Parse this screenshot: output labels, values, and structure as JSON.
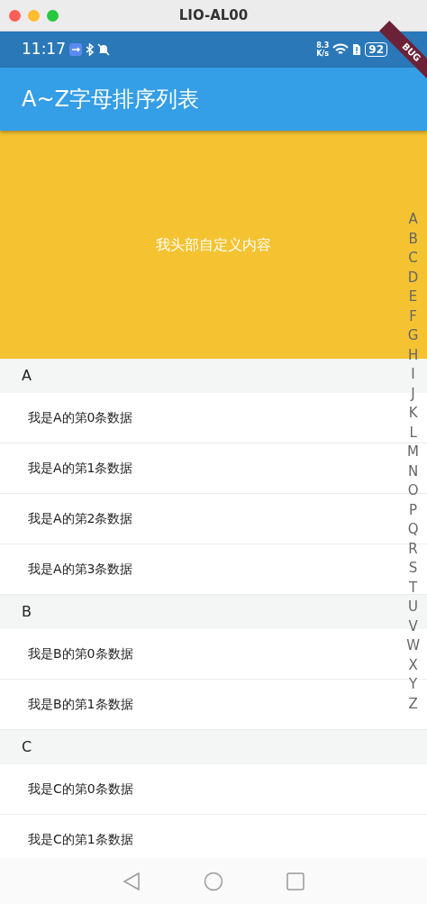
{
  "window": {
    "title": "LIO-AL00"
  },
  "status_bar": {
    "time": "11:17",
    "net_speed_value": "8.3",
    "net_speed_unit": "K/s",
    "battery": "92"
  },
  "debug_banner": "BUG",
  "app_bar": {
    "title": "A~Z字母排序列表"
  },
  "header": {
    "text": "我头部自定义内容"
  },
  "sections": [
    {
      "letter": "A",
      "items": [
        "我是A的第0条数据",
        "我是A的第1条数据",
        "我是A的第2条数据",
        "我是A的第3条数据"
      ]
    },
    {
      "letter": "B",
      "items": [
        "我是B的第0条数据",
        "我是B的第1条数据"
      ]
    },
    {
      "letter": "C",
      "items": [
        "我是C的第0条数据",
        "我是C的第1条数据"
      ]
    }
  ],
  "index_bar": [
    "A",
    "B",
    "C",
    "D",
    "E",
    "F",
    "G",
    "H",
    "I",
    "J",
    "K",
    "L",
    "M",
    "N",
    "O",
    "P",
    "Q",
    "R",
    "S",
    "T",
    "U",
    "V",
    "W",
    "X",
    "Y",
    "Z"
  ]
}
